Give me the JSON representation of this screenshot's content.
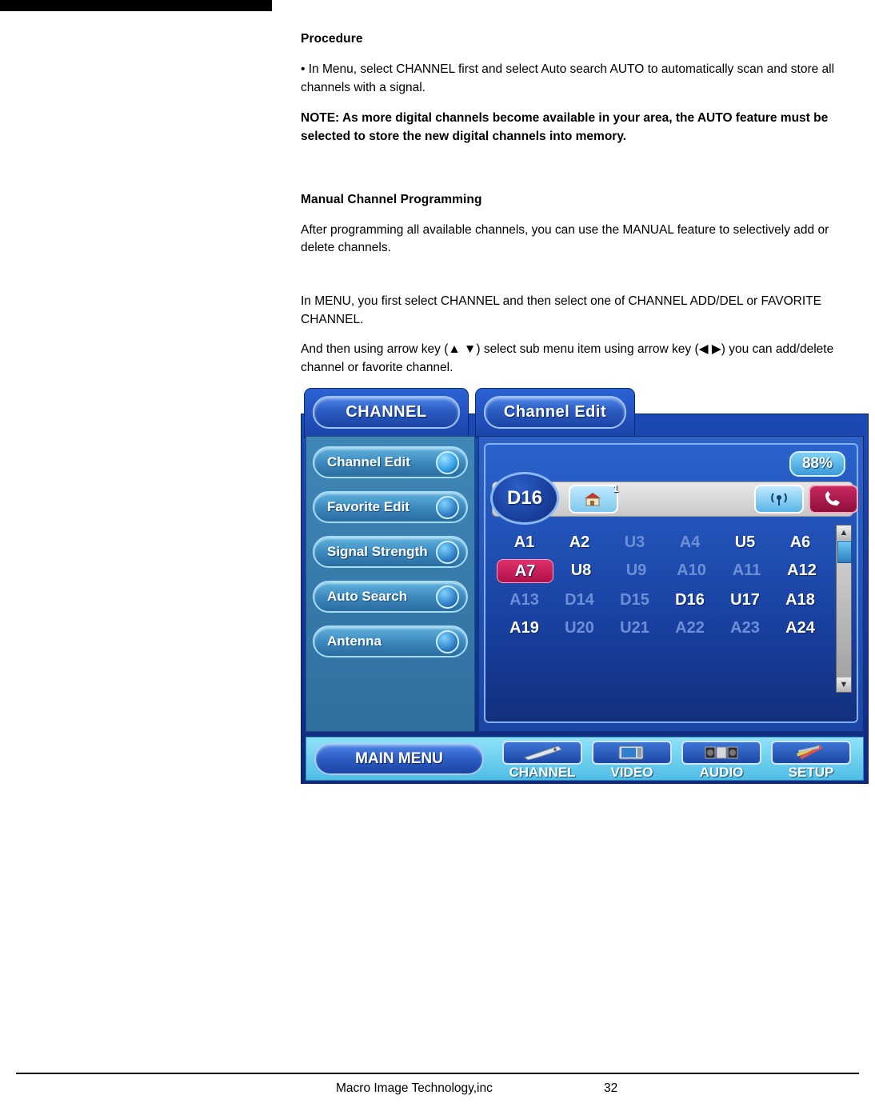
{
  "page": {
    "heading": "Procedure",
    "bullet": "•  In Menu, select CHANNEL first and select Auto search AUTO to automatically  scan and store all channels with a signal.",
    "note": "NOTE: As more digital channels become available in your area, the AUTO feature must be selected to store the new digital channels into memory.",
    "section_title": "Manual Channel Programming",
    "paragraph1": "After programming all available channels, you can use the MANUAL feature to selectively add or delete channels.",
    "paragraph2": "In MENU, you first select CHANNEL and then select one of CHANNEL ADD/DEL or FAVORITE CHANNEL.",
    "paragraph3": "And then using arrow key (▲ ▼) select sub menu item using arrow key (◀ ▶) you can add/delete channel or favorite channel."
  },
  "osd": {
    "tab_main": "CHANNEL",
    "tab_sub": "Channel Edit",
    "menu_items": [
      {
        "label": "Channel Edit",
        "selected": true
      },
      {
        "label": "Favorite Edit",
        "selected": false
      },
      {
        "label": "Signal Strength",
        "selected": false
      },
      {
        "label": "Auto Search",
        "selected": false
      },
      {
        "label": "Antenna",
        "selected": false
      }
    ],
    "signal_percent": "88%",
    "current_channel": "D16",
    "house_badge": "1",
    "icons": {
      "house": "house-icon",
      "antenna": "antenna-icon",
      "phone": "phone-icon",
      "scroll_up": "▲",
      "scroll_down": "▼"
    },
    "channel_grid": [
      [
        {
          "t": "A1",
          "s": "bright"
        },
        {
          "t": "A2",
          "s": "bright"
        },
        {
          "t": "U3",
          "s": "dim"
        },
        {
          "t": "A4",
          "s": "dim"
        },
        {
          "t": "U5",
          "s": "bright"
        },
        {
          "t": "A6",
          "s": "bright"
        }
      ],
      [
        {
          "t": "A7",
          "s": "selected"
        },
        {
          "t": "U8",
          "s": "bright"
        },
        {
          "t": "U9",
          "s": "dim"
        },
        {
          "t": "A10",
          "s": "dim"
        },
        {
          "t": "A11",
          "s": "dim"
        },
        {
          "t": "A12",
          "s": "bright"
        }
      ],
      [
        {
          "t": "A13",
          "s": "dim"
        },
        {
          "t": "D14",
          "s": "dim"
        },
        {
          "t": "D15",
          "s": "dim"
        },
        {
          "t": "D16",
          "s": "bright"
        },
        {
          "t": "U17",
          "s": "bright"
        },
        {
          "t": "A18",
          "s": "bright"
        }
      ],
      [
        {
          "t": "A19",
          "s": "bright"
        },
        {
          "t": "U20",
          "s": "dim"
        },
        {
          "t": "U21",
          "s": "dim"
        },
        {
          "t": "A22",
          "s": "dim"
        },
        {
          "t": "A23",
          "s": "dim"
        },
        {
          "t": "A24",
          "s": "bright"
        }
      ]
    ],
    "main_menu_label": "MAIN MENU",
    "bottom_items": [
      {
        "label": "CHANNEL",
        "icon": "remote-icon"
      },
      {
        "label": "VIDEO",
        "icon": "tv-icon"
      },
      {
        "label": "AUDIO",
        "icon": "speaker-icon"
      },
      {
        "label": "SETUP",
        "icon": "tools-icon"
      }
    ]
  },
  "footer": {
    "company": "Macro Image Technology,inc",
    "page_number": "32"
  }
}
